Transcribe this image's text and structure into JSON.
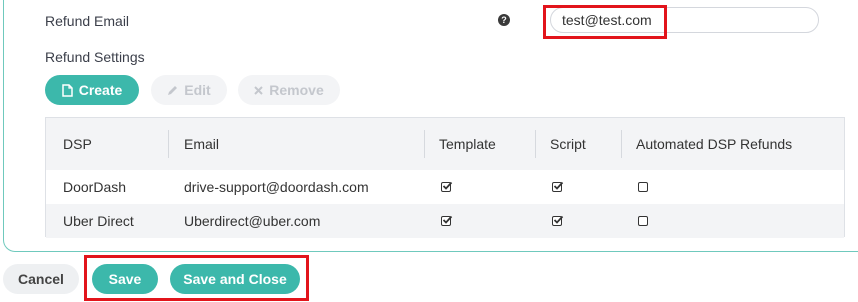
{
  "form": {
    "refund_email_label": "Refund Email",
    "help_glyph": "?",
    "refund_email_value": "test@test.com",
    "refund_settings_label": "Refund Settings"
  },
  "toolbar": {
    "create_label": "Create",
    "edit_label": "Edit",
    "remove_label": "Remove"
  },
  "table": {
    "columns": [
      "DSP",
      "Email",
      "Template",
      "Script",
      "Automated DSP Refunds"
    ],
    "rows": [
      {
        "dsp": "DoorDash",
        "email": "drive-support@doordash.com",
        "template": true,
        "script": true,
        "automated": false
      },
      {
        "dsp": "Uber Direct",
        "email": "Uberdirect@uber.com",
        "template": true,
        "script": true,
        "automated": false
      }
    ]
  },
  "footer": {
    "cancel_label": "Cancel",
    "save_label": "Save",
    "save_close_label": "Save and Close"
  },
  "colors": {
    "accent": "#3cb8ab",
    "highlight": "#e2141b"
  },
  "icons": {
    "create": "file-icon",
    "edit": "pencil-icon",
    "remove": "x-icon",
    "help": "question-circle-icon"
  }
}
